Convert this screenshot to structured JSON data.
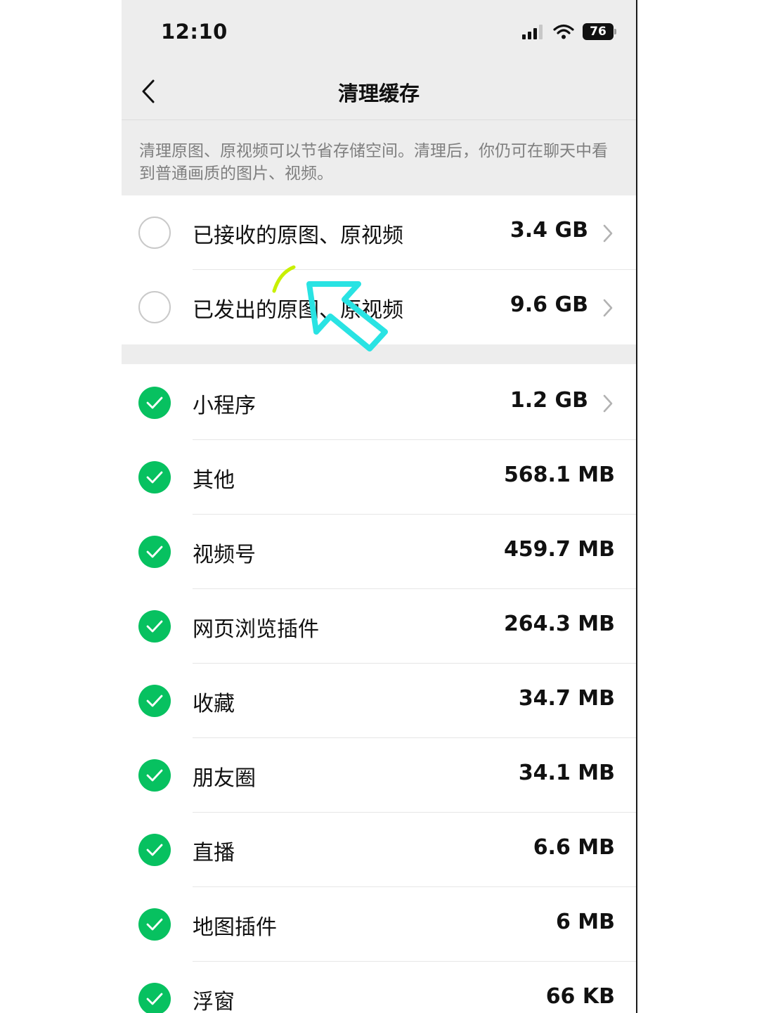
{
  "status_bar": {
    "time": "12:10",
    "battery": "76"
  },
  "nav": {
    "title": "清理缓存"
  },
  "description": "清理原图、原视频可以节省存储空间。清理后，你仍可在聊天中看到普通画质的图片、视频。",
  "media_rows": [
    {
      "label": "已接收的原图、原视频",
      "size": "3.4 GB",
      "checked": false
    },
    {
      "label": "已发出的原图、原视频",
      "size": "9.6 GB",
      "checked": false
    }
  ],
  "cache_rows": [
    {
      "label": "小程序",
      "size": "1.2 GB",
      "checked": true
    },
    {
      "label": "其他",
      "size": "568.1 MB",
      "checked": true
    },
    {
      "label": "视频号",
      "size": "459.7 MB",
      "checked": true
    },
    {
      "label": "网页浏览插件",
      "size": "264.3 MB",
      "checked": true
    },
    {
      "label": "收藏",
      "size": "34.7 MB",
      "checked": true
    },
    {
      "label": "朋友圈",
      "size": "34.1 MB",
      "checked": true
    },
    {
      "label": "直播",
      "size": "6.6 MB",
      "checked": true
    },
    {
      "label": "地图插件",
      "size": "6 MB",
      "checked": true
    },
    {
      "label": "浮窗",
      "size": "66 KB",
      "checked": true
    }
  ],
  "colors": {
    "accent": "#07c160",
    "annotation_arrow": "#29e3e3",
    "annotation_stroke": "#c8f000"
  }
}
